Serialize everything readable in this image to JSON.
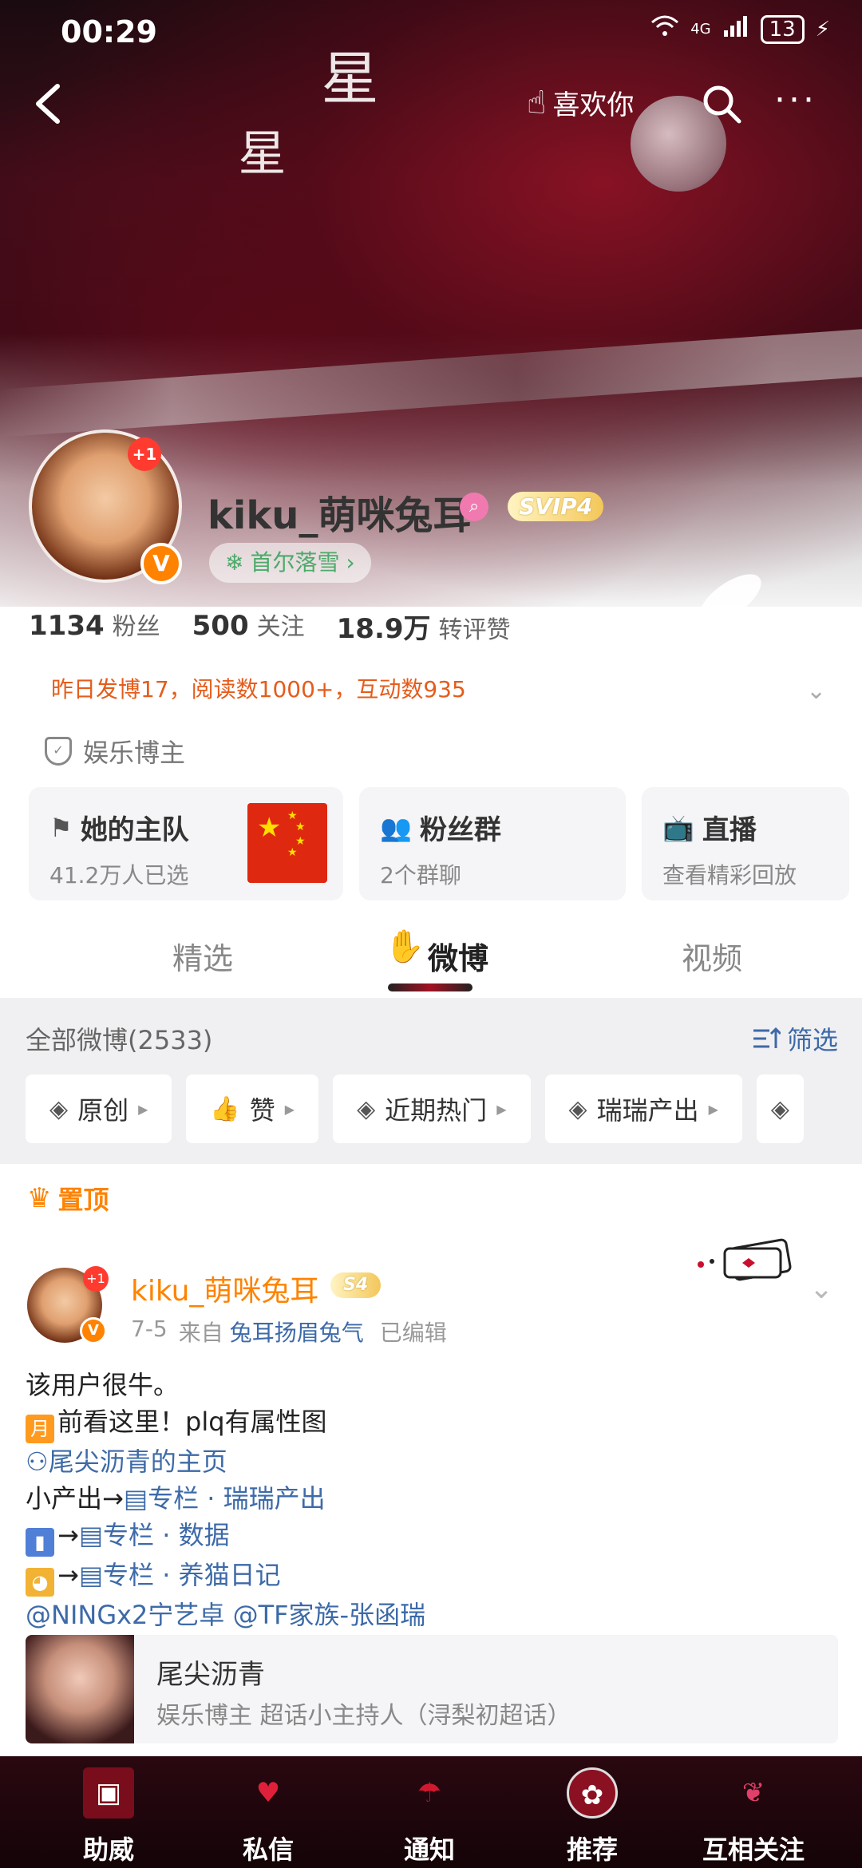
{
  "status_bar": {
    "time": "00:29",
    "network": "4G",
    "battery": "13"
  },
  "nav": {
    "like_you_label": "喜欢你"
  },
  "profile": {
    "avatar_badge": "+1",
    "verify_mark": "V",
    "username": "kiku_萌咪兔耳",
    "vip_badge": "SVIP4",
    "group_label": "首尔落雪",
    "stats": [
      {
        "value": "1134",
        "label": "粉丝"
      },
      {
        "value": "500",
        "label": "关注"
      },
      {
        "value": "18.9万",
        "label": "转评赞"
      }
    ],
    "activity": "昨日发博17，阅读数1000+，互动数935",
    "role": "娱乐博主"
  },
  "cards": [
    {
      "title": "她的主队",
      "subtitle": "41.2万人已选"
    },
    {
      "title": "粉丝群",
      "subtitle": "2个群聊"
    },
    {
      "title": "直播",
      "subtitle": "查看精彩回放"
    }
  ],
  "tabs": [
    {
      "label": "精选",
      "active": false
    },
    {
      "label": "微博",
      "active": true
    },
    {
      "label": "视频",
      "active": false
    }
  ],
  "feed_header": {
    "all_label": "全部微博(2533)",
    "filter_label": "筛选"
  },
  "chips": [
    {
      "label": "原创",
      "icon": "layers-icon"
    },
    {
      "label": "赞",
      "icon": "thumbs-up-icon"
    },
    {
      "label": "近期热门",
      "icon": "layers-icon"
    },
    {
      "label": "瑞瑞产出",
      "icon": "layers-icon"
    }
  ],
  "pinned_label": "置顶",
  "post": {
    "author": "kiku_萌咪兔耳",
    "level_badge": "S4",
    "date": "7-5",
    "from_label": "来自",
    "source": "兔耳扬眉兔气",
    "edited": "已编辑",
    "lines": {
      "l1": "该用户很牛。",
      "l2_emoji": "月",
      "l2_text": "前看这里！plq有属性图",
      "l3": "尾尖沥青的主页",
      "l4_prefix": "小产出→",
      "l4_link": "专栏 · 瑞瑞产出",
      "l5_prefix": "→",
      "l5_link": "专栏 · 数据",
      "l6_prefix": "→",
      "l6_link": "专栏 · 养猫日记",
      "l7_mention1": "@NINGx2宁艺卓",
      "l7_mention2": "@TF家族-张函瑞"
    },
    "card": {
      "name": "尾尖沥青",
      "desc": "娱乐博主 超话小主持人（浔梨初超话）"
    }
  },
  "bottom_nav": [
    {
      "label": "助威",
      "icon": "frame-icon"
    },
    {
      "label": "私信",
      "icon": "heart-icon"
    },
    {
      "label": "通知",
      "icon": "umbrella-icon"
    },
    {
      "label": "推荐",
      "icon": "flower-icon"
    },
    {
      "label": "互相关注",
      "icon": "butterfly-icon"
    }
  ],
  "colors": {
    "accent": "#ff8200",
    "link": "#3d6aa8",
    "activity": "#e55c1b"
  }
}
